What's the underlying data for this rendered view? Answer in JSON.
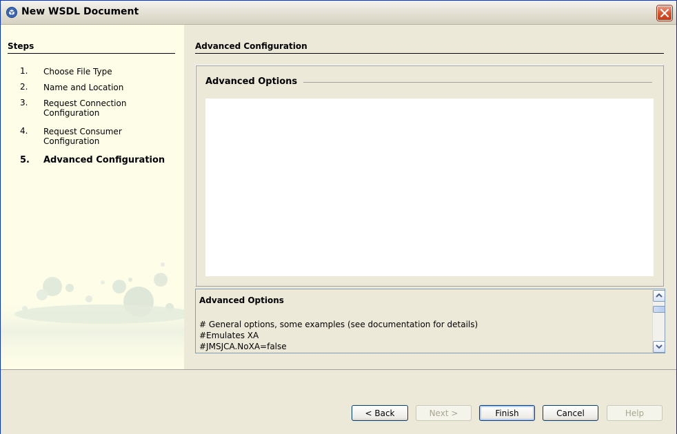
{
  "window": {
    "title": "New WSDL Document",
    "accent": "#0831d9",
    "close_color": "#d9542f"
  },
  "steps": {
    "title": "Steps",
    "items": [
      {
        "num": "1.",
        "label": "Choose File Type"
      },
      {
        "num": "2.",
        "label": "Name and Location"
      },
      {
        "num": "3.",
        "label": "Request Connection Configuration"
      },
      {
        "num": "4.",
        "label": "Request Consumer Configuration"
      },
      {
        "num": "5.",
        "label": "Advanced Configuration"
      }
    ],
    "current_index": 4
  },
  "main": {
    "section_title": "Advanced Configuration",
    "group_title": "Advanced Options",
    "description": {
      "title": "Advanced Options",
      "lines": [
        "# General options, some examples (see documentation for details)",
        "#Emulates XA",
        "#JMSJCA.NoXA=false"
      ]
    }
  },
  "buttons": {
    "back": "< Back",
    "next": "Next >",
    "finish": "Finish",
    "cancel": "Cancel",
    "help": "Help"
  }
}
